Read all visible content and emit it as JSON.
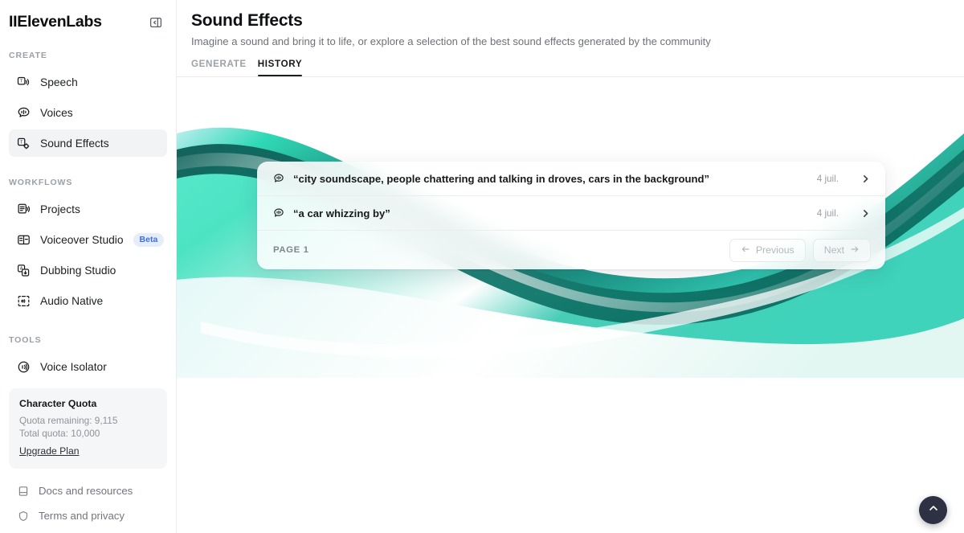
{
  "brand": {
    "name": "IIElevenLabs",
    "collapse_icon": "panel-collapse-icon"
  },
  "sidebar": {
    "sections": [
      {
        "label": "CREATE",
        "items": [
          {
            "label": "Speech",
            "icon": "speech-icon",
            "active": false
          },
          {
            "label": "Voices",
            "icon": "voices-icon",
            "active": false
          },
          {
            "label": "Sound Effects",
            "icon": "sound-effects-icon",
            "active": true
          }
        ]
      },
      {
        "label": "WORKFLOWS",
        "items": [
          {
            "label": "Projects",
            "icon": "projects-icon",
            "active": false
          },
          {
            "label": "Voiceover Studio",
            "icon": "voiceover-studio-icon",
            "active": false,
            "badge": "Beta"
          },
          {
            "label": "Dubbing Studio",
            "icon": "dubbing-studio-icon",
            "active": false
          },
          {
            "label": "Audio Native",
            "icon": "audio-native-icon",
            "active": false
          }
        ]
      },
      {
        "label": "TOOLS",
        "items": [
          {
            "label": "Voice Isolator",
            "icon": "voice-isolator-icon",
            "active": false
          }
        ]
      }
    ],
    "quota": {
      "title": "Character Quota",
      "remaining": "Quota remaining: 9,115",
      "total": "Total quota: 10,000",
      "upgrade_link": "Upgrade Plan"
    },
    "footer": [
      {
        "label": "Docs and resources",
        "icon": "book-icon"
      },
      {
        "label": "Terms and privacy",
        "icon": "shield-icon"
      }
    ]
  },
  "header": {
    "title": "Sound Effects",
    "subtitle": "Imagine a sound and bring it to life, or explore a selection of the best sound effects generated by the community",
    "tabs": [
      {
        "label": "GENERATE",
        "active": false
      },
      {
        "label": "HISTORY",
        "active": true
      }
    ]
  },
  "history": {
    "rows": [
      {
        "icon": "sound-effect-bubble-icon",
        "text": "“city soundscape, people chattering and talking in droves, cars in the background”",
        "date": "4 juil.",
        "chevron": "chevron-right-icon"
      },
      {
        "icon": "sound-effect-bubble-icon",
        "text": "“a car whizzing by”",
        "date": "4 juil.",
        "chevron": "chevron-right-icon"
      }
    ],
    "pagination": {
      "page_label": "PAGE 1",
      "previous_label": "Previous",
      "next_label": "Next"
    }
  },
  "fab": {
    "icon": "chevron-up-icon"
  },
  "colors": {
    "accent_teal_light": "#4fe3c4",
    "accent_teal_dark": "#177a6e",
    "badge_bg": "#e5edfb",
    "badge_text": "#3f6fd8",
    "fab_bg": "#2e3043",
    "active_nav_bg": "#f1f3f4"
  }
}
